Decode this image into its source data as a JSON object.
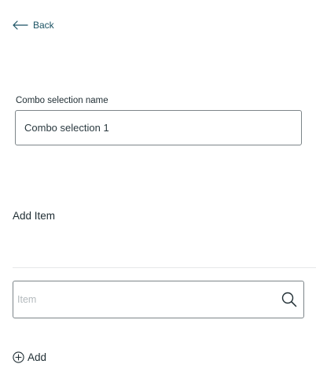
{
  "nav": {
    "back_label": "Back",
    "back_icon": "arrow-left-icon"
  },
  "combo": {
    "name_label": "Combo selection name",
    "name_value": "Combo selection 1"
  },
  "items": {
    "heading": "Add Item",
    "search_placeholder": "Item",
    "search_icon": "search-icon",
    "add_label": "Add",
    "add_icon": "plus-circle-icon"
  },
  "colors": {
    "link": "#1a5263",
    "text": "#1f2d33",
    "border": "#7d8589",
    "placeholder": "#b4babd",
    "divider": "#e6e8e9"
  }
}
